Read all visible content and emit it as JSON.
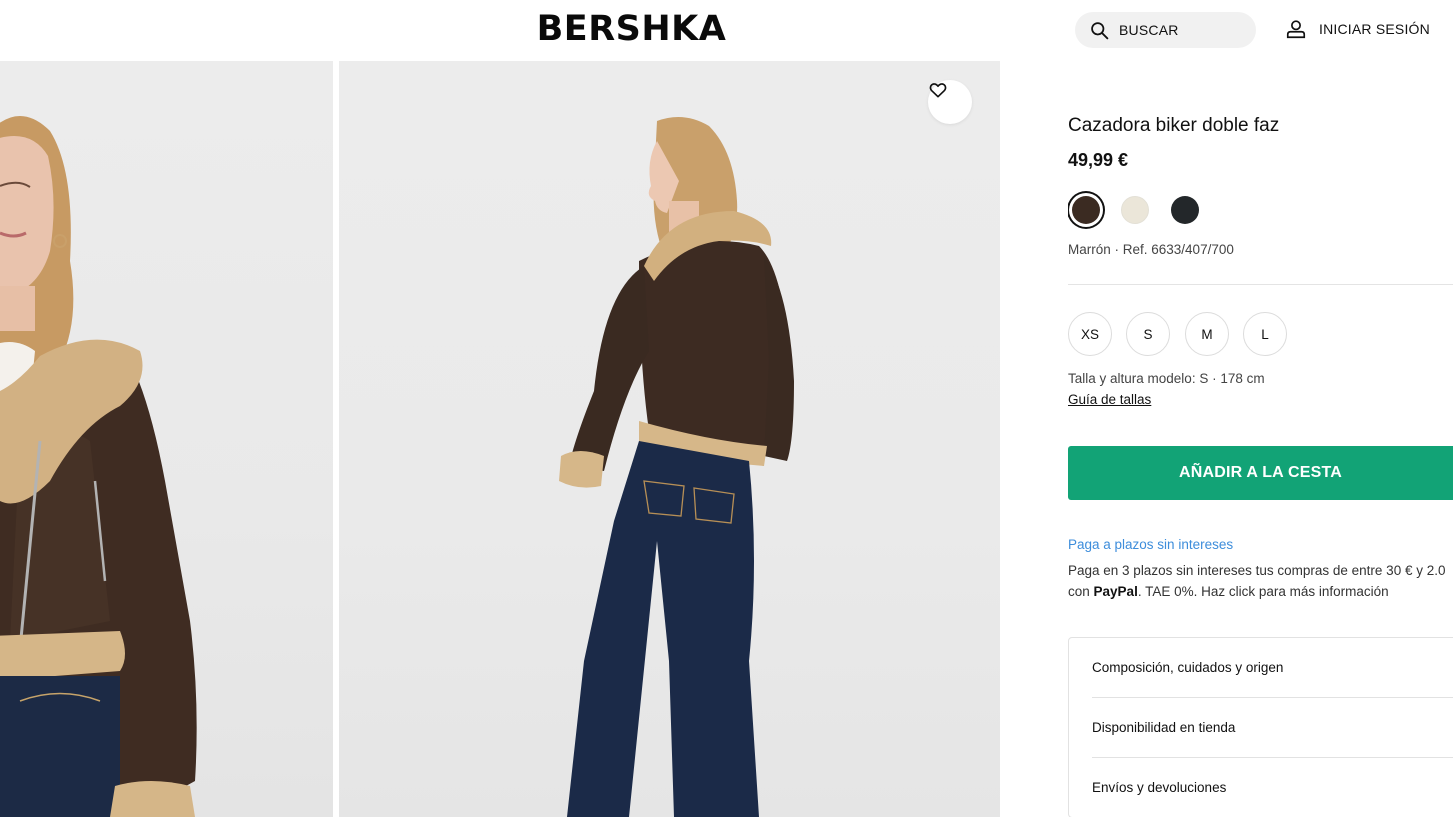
{
  "header": {
    "logo": "BERSHKA",
    "search_label": "BUSCAR",
    "search_icon": "search-icon",
    "login_label": "INICIAR SESIÓN",
    "login_icon": "user-icon"
  },
  "gallery": {
    "favorite_icon": "heart-icon"
  },
  "product": {
    "title": "Cazadora biker doble faz",
    "price": "49,99 €",
    "colors": [
      {
        "name": "brown",
        "hex": "#3b2b22",
        "selected": true
      },
      {
        "name": "cream",
        "hex": "#ebe6d9",
        "selected": false
      },
      {
        "name": "black",
        "hex": "#23272a",
        "selected": false
      }
    ],
    "color_ref": "Marrón · Ref. 6633/407/700",
    "sizes": [
      "XS",
      "S",
      "M",
      "L"
    ],
    "model_info": "Talla y altura modelo: S · 178 cm",
    "size_guide": "Guía de tallas",
    "add_to_cart": "AÑADIR A LA CESTA",
    "add_to_cart_color": "#12a376",
    "payment": {
      "link": "Paga a plazos sin intereses",
      "line1": "Paga en 3 plazos sin intereses tus compras de entre 30 € y 2.0",
      "line2_prefix": "con ",
      "line2_brand": "PayPal",
      "line2_suffix": ". TAE 0%. Haz click para más información"
    },
    "accordion": [
      "Composición, cuidados y origen",
      "Disponibilidad en tienda",
      "Envíos y devoluciones"
    ]
  }
}
